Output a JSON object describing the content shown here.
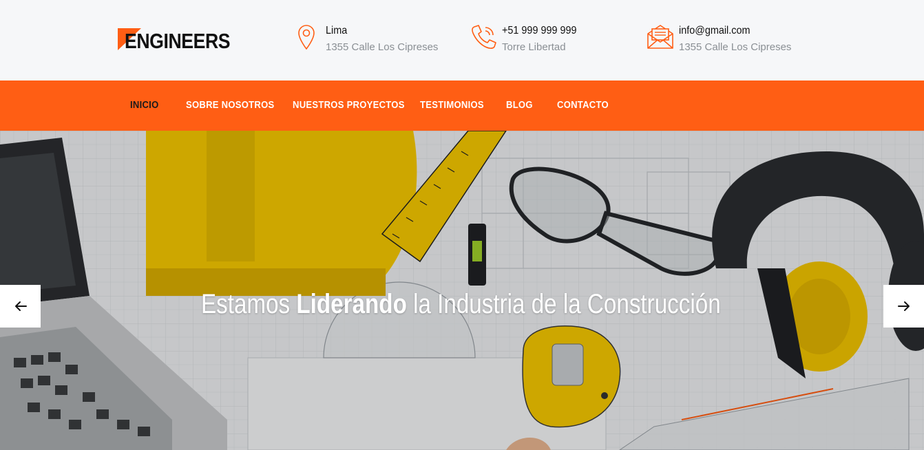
{
  "brand": {
    "logo_text": "ENGINEERS",
    "accent": "#ff5e14"
  },
  "contacts": [
    {
      "icon": "location-pin-icon",
      "title": "Lima",
      "subtitle": "1355 Calle Los Cipreses"
    },
    {
      "icon": "phone-icon",
      "title": "+51 999 999 999",
      "subtitle": "Torre Libertad"
    },
    {
      "icon": "mail-icon",
      "title": "info@gmail.com",
      "subtitle": "1355 Calle Los Cipreses"
    }
  ],
  "nav": {
    "items": [
      {
        "label": "INICIO",
        "active": true
      },
      {
        "label": "SOBRE NOSOTROS",
        "active": false
      },
      {
        "label": "NUESTROS PROYECTOS",
        "active": false
      },
      {
        "label": "TESTIMONIOS",
        "active": false
      },
      {
        "label": "BLOG",
        "active": false
      },
      {
        "label": "CONTACTO",
        "active": false
      }
    ]
  },
  "hero": {
    "headline_pre": "Estamos ",
    "headline_strong": "Liderando",
    "headline_post": " la Industria de la Construcción",
    "prev_icon": "arrow-left-icon",
    "next_icon": "arrow-right-icon"
  }
}
